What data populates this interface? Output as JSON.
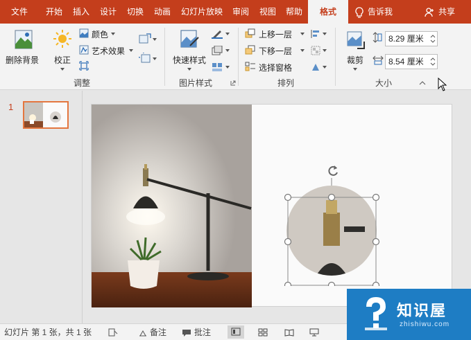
{
  "menu": {
    "items": [
      "文件",
      "开始",
      "插入",
      "设计",
      "切换",
      "动画",
      "幻灯片放映",
      "审阅",
      "视图",
      "帮助",
      "格式"
    ],
    "active": "格式",
    "tell_me": "告诉我",
    "share": "共享"
  },
  "ribbon": {
    "adjust": {
      "remove_bg": "删除背景",
      "corrections": "校正",
      "color": "颜色",
      "artistic": "艺术效果",
      "group": "调整"
    },
    "styles": {
      "quick": "快速样式",
      "group": "图片样式"
    },
    "arrange": {
      "forward": "上移一层",
      "backward": "下移一层",
      "pane": "选择窗格",
      "group": "排列"
    },
    "size": {
      "crop": "裁剪",
      "height": "8.29 厘米",
      "width": "8.54 厘米",
      "group": "大小"
    }
  },
  "slides_panel": {
    "number": "1"
  },
  "status": {
    "slide_info": "幻灯片 第 1 张，共 1 张",
    "notes": "备注",
    "comments": "批注"
  },
  "watermark": {
    "title": "知识屋",
    "url": "zhishiwu.com"
  },
  "colors": {
    "accent": "#c43e1c",
    "watermark": "#1e7dc4"
  }
}
